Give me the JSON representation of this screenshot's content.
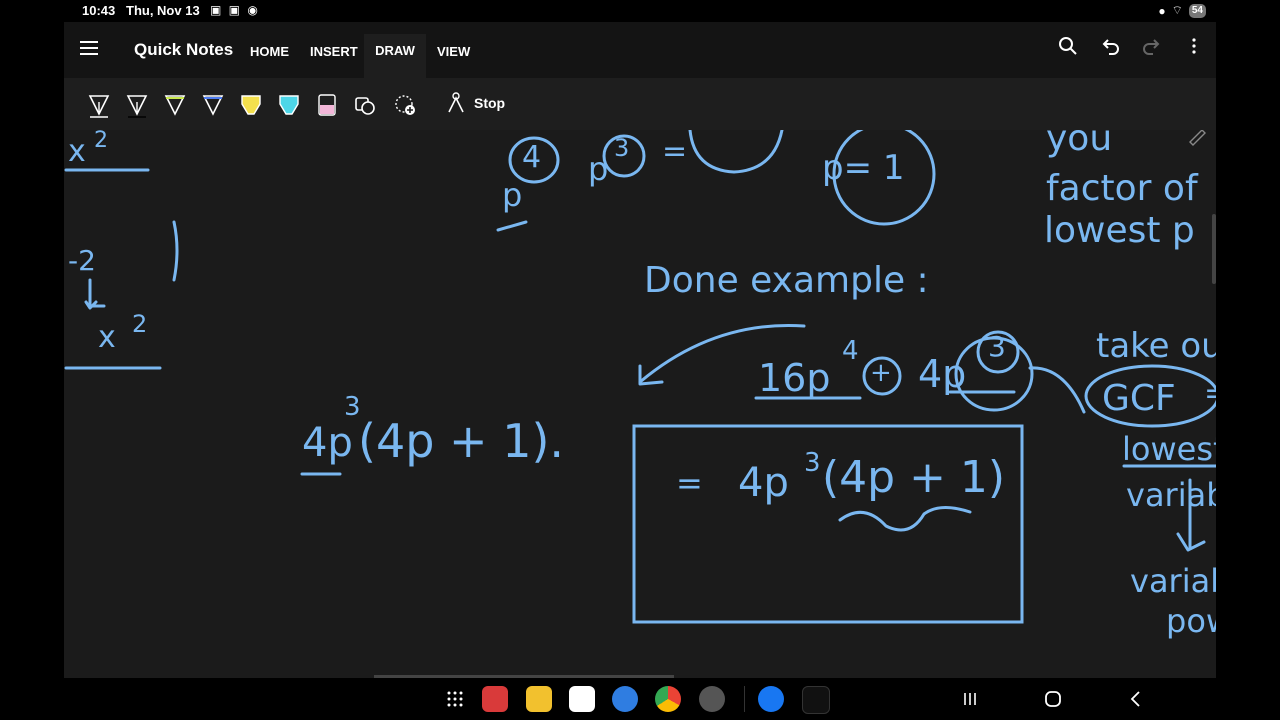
{
  "status": {
    "time": "10:43",
    "date": "Thu, Nov 13",
    "battery": "54"
  },
  "app": {
    "title": "Quick Notes"
  },
  "tabs": [
    {
      "label": "HOME"
    },
    {
      "label": "INSERT"
    },
    {
      "label": "DRAW"
    },
    {
      "label": "VIEW"
    }
  ],
  "toolbar": {
    "stop_label": "Stop"
  },
  "note": {
    "heading": "Done example :",
    "expression": "16p",
    "expression_exp": "4",
    "plus": "+",
    "term2": "4p",
    "term2_exp": "3",
    "result_left": "4p",
    "result_left_exp": "3",
    "result_paren": "(4p + 1).",
    "boxed_eq": "=",
    "boxed_coeff": "4p",
    "boxed_exp": "3",
    "boxed_paren": "(4p + 1)",
    "side_1": "take ou",
    "side_gcf": "GCF",
    "side_gcf_eq": "=",
    "side_3": "lowest",
    "side_4": "variabl",
    "side_5": "variabl",
    "side_6": "pow",
    "top_right_1": "you",
    "top_right_2": "factor of",
    "top_right_3": "lowest p",
    "top_p_eq": "p= 1",
    "top_mid_4": "4",
    "top_mid_p": "p",
    "top_mid_3": "3",
    "top_mid_eq": "=",
    "left_top": "x",
    "left_top_exp": "2",
    "left_mid": "-2",
    "left_low": "x",
    "left_low_exp": "2"
  },
  "colors": {
    "ink": "#7ab7f0",
    "canvas": "#1b1b1b",
    "appbar": "#141414",
    "toolbar": "#1e1e1e",
    "highlighter_yellow": "#f4e04d",
    "highlighter_cyan": "#4dd6e8",
    "highlighter_pink": "#f2b6d8"
  }
}
